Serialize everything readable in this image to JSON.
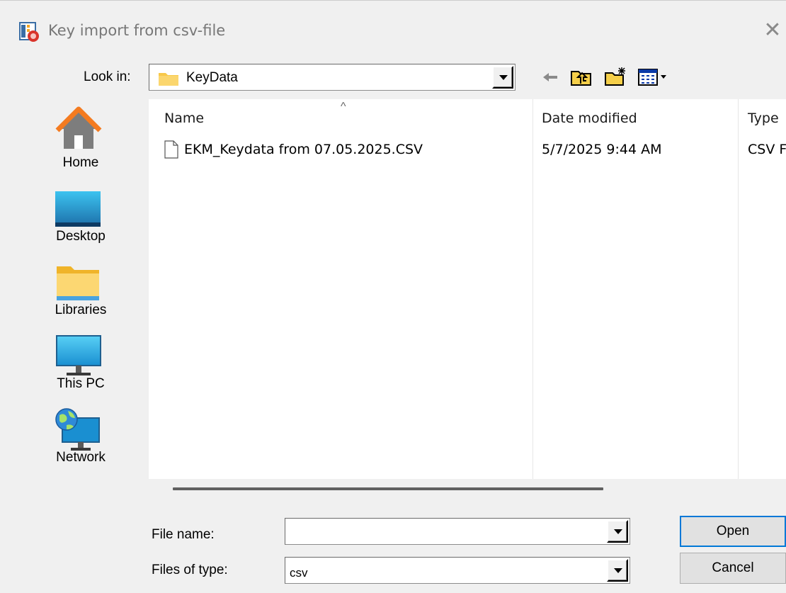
{
  "window": {
    "title": "Key import from csv-file",
    "close_glyph": "✕"
  },
  "lookin": {
    "label": "Look in:",
    "value": "KeyData"
  },
  "places": [
    {
      "label": "Home",
      "icon": "home-icon"
    },
    {
      "label": "Desktop",
      "icon": "desktop-icon"
    },
    {
      "label": "Libraries",
      "icon": "libraries-icon"
    },
    {
      "label": "This PC",
      "icon": "this-pc-icon"
    },
    {
      "label": "Network",
      "icon": "network-icon"
    }
  ],
  "filelist": {
    "columns": [
      "Name",
      "Date modified",
      "Type"
    ],
    "sort_indicator": "^",
    "files": [
      {
        "name": "EKM_Keydata from 07.05.2025.CSV",
        "date": "5/7/2025 9:44 AM",
        "type": "CSV F"
      }
    ]
  },
  "form": {
    "file_name_label": "File name:",
    "file_name_value": "",
    "file_type_label": "Files of type:",
    "file_type_value": "csv",
    "open_label": "Open",
    "cancel_label": "Cancel"
  }
}
